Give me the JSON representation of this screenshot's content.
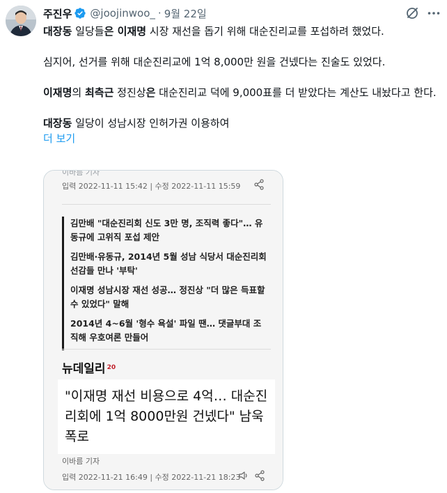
{
  "tweet": {
    "author_name": "주진우",
    "handle": "@joojinwoo_",
    "separator": "·",
    "date": "9월 22일",
    "p1_a": "대장동",
    "p1_b": " 일당들",
    "p1_c": "은 ",
    "p1_d": "이재명",
    "p1_e": " 시장 재선을 돕기 위해 대순진리교를 포섭하려 했었다.",
    "p2": "심지어, 선거를 위해 대순진리교에 1억 8,000만 원을 건넸다는 진술도 있었다.",
    "p3_a": "이재명",
    "p3_b": "의 ",
    "p3_c": "최측근",
    "p3_d": " 정진상",
    "p3_e": "은",
    "p3_f": " 대순진리교 덕에 9,000표를 더 받았다는 계산도 내놨다고 한다.",
    "p4_a": "대장동",
    "p4_b": " 일당이 성남시장 인허가권 이용하여",
    "show_more": "더 보기",
    "verified_color": "#1d9bf0",
    "link_color": "#1d9bf0"
  },
  "article": {
    "reporter_top": "이바름 기자",
    "meta_top": "입력 2022-11-11 15:42 | 수정 2022-11-11 15:59",
    "related": [
      "김만배 \"대순진리회 신도 3만 명, 조직력 좋다\"… 유동규에 고위직 포섭 제안",
      "김만배·유동규, 2014년 5월 성남 식당서 대순진리회 선감들 만나 '부탁'",
      "이재명 성남시장 재선 성공… 정진상 \"더 많은 득표할 수 있었다\" 말해",
      "2014년 4~6월 '형수 욕설' 파일 땐… 댓글부대 조직해 우호여론 만들어"
    ],
    "logo_text": "뉴데일리",
    "logo_badge": "20",
    "headline": "\"이재명 재선 비용으로 4억… 대순진리회에 1억 8000만원 건넸다\" 남욱 폭로",
    "reporter_bottom": "이바름 기자",
    "meta_bottom": "입력 2022-11-21 16:49 | 수정 2022-11-21 18:23"
  },
  "icons": {
    "avatar": "profile-photo",
    "verified": "verified-badge-icon",
    "grok": "grok-icon",
    "more": "more-options-icon",
    "share": "share-icon",
    "speaker": "speaker-icon"
  }
}
